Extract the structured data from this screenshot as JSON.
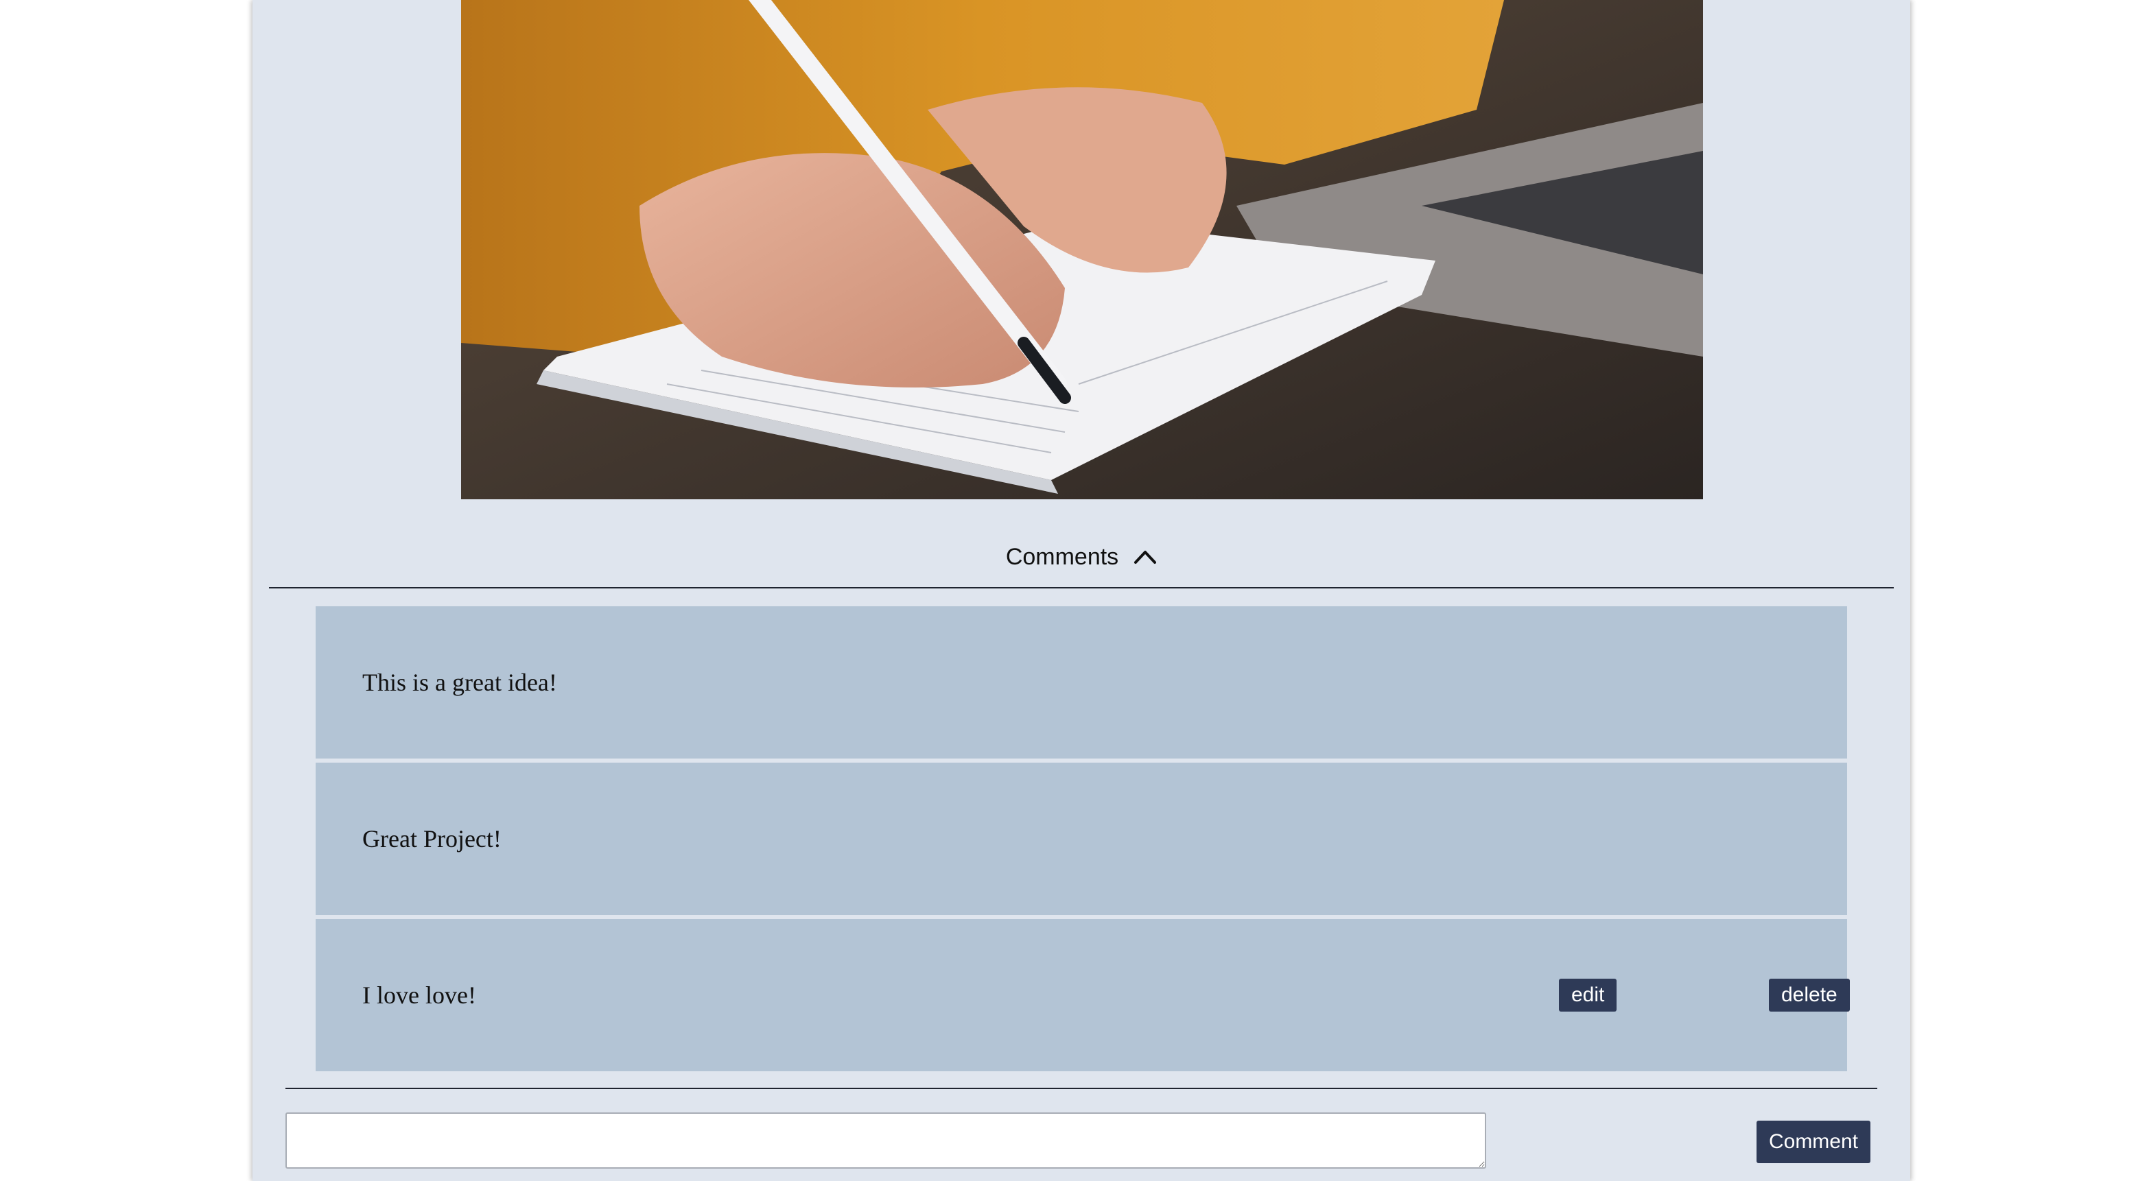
{
  "post": {
    "image_subject": "hand writing in notebook with pen"
  },
  "comments_section": {
    "title": "Comments",
    "toggle_icon": "chevron-up-icon",
    "items": [
      {
        "text": "This is a great idea!"
      },
      {
        "text": "Great Project!"
      },
      {
        "text": "I love love!",
        "edit_label": "edit",
        "delete_label": "delete"
      }
    ]
  },
  "composer": {
    "input_value": "",
    "submit_label": "Comment"
  },
  "colors": {
    "panel_background": "#dfe5ee",
    "comment_background": "#b3c4d5",
    "button_background": "#2e3a57",
    "divider": "#1f2430"
  }
}
